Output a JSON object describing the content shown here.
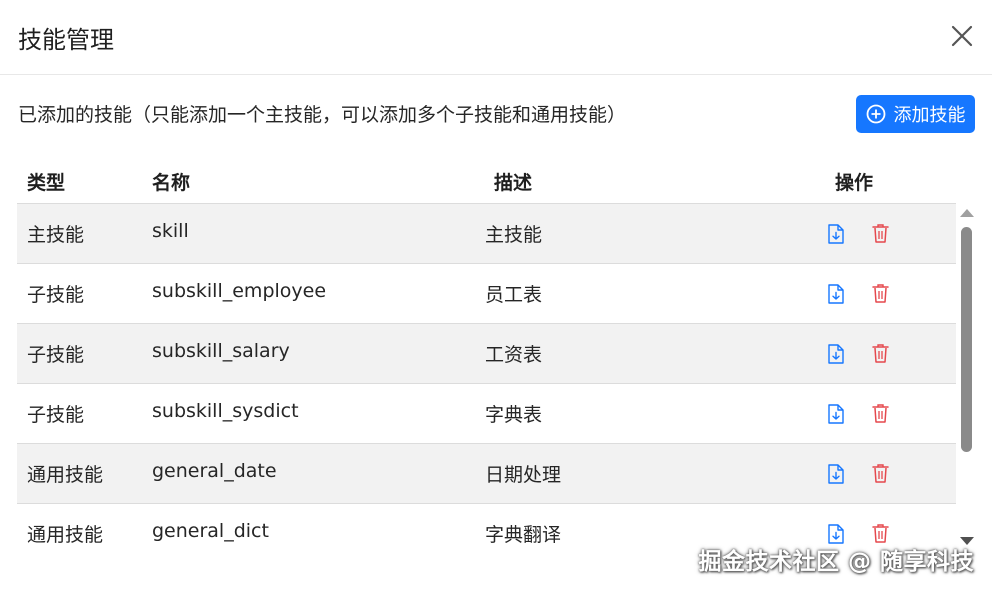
{
  "dialog": {
    "title": "技能管理",
    "subtitle": "已添加的技能（只能添加一个主技能，可以添加多个子技能和通用技能）",
    "add_button_label": "添加技能"
  },
  "table": {
    "columns": [
      "类型",
      "名称",
      "描述",
      "操作"
    ],
    "rows": [
      {
        "type": "主技能",
        "name": "skill",
        "desc": "主技能"
      },
      {
        "type": "子技能",
        "name": "subskill_employee",
        "desc": "员工表"
      },
      {
        "type": "子技能",
        "name": "subskill_salary",
        "desc": "工资表"
      },
      {
        "type": "子技能",
        "name": "subskill_sysdict",
        "desc": "字典表"
      },
      {
        "type": "通用技能",
        "name": "general_date",
        "desc": "日期处理"
      },
      {
        "type": "通用技能",
        "name": "general_dict",
        "desc": "字典翻译"
      }
    ]
  },
  "icons": {
    "close": "close-icon",
    "add": "plus-circle-icon",
    "view": "file-download-icon",
    "delete": "trash-icon"
  },
  "colors": {
    "primary": "#1677ff",
    "view_icon": "#1677ff",
    "delete_icon": "#e5484d",
    "stripe": "#f2f2f2"
  },
  "watermark": "掘金技术社区 @ 随享科技"
}
